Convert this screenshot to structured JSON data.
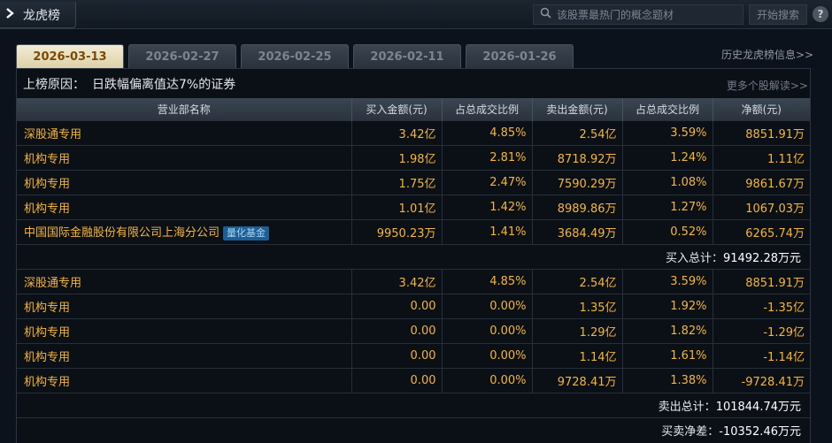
{
  "header": {
    "title": "龙虎榜",
    "search_placeholder": "该股票最热门的概念题材",
    "search_button": "开始搜索",
    "help_label": "?"
  },
  "tabs": [
    {
      "label": "2026-03-13",
      "active": true
    },
    {
      "label": "2026-02-27",
      "active": false
    },
    {
      "label": "2026-02-25",
      "active": false
    },
    {
      "label": "2026-02-11",
      "active": false
    },
    {
      "label": "2026-01-26",
      "active": false
    }
  ],
  "history_link": "历史龙虎榜信息>>",
  "reason": {
    "label": "上榜原因：",
    "value": "日跌幅偏离值达7%的证券"
  },
  "more_link": "更多个股解读>>",
  "columns": [
    "营业部名称",
    "买入金额(元)",
    "占总成交比例",
    "卖出金额(元)",
    "占总成交比例",
    "净额(元)"
  ],
  "buy_rows": [
    {
      "name": "深股通专用",
      "badge": "",
      "buy": "3.42亿",
      "buy_pct": "4.85%",
      "sell": "2.54亿",
      "sell_pct": "3.59%",
      "net": "8851.91万"
    },
    {
      "name": "机构专用",
      "badge": "",
      "buy": "1.98亿",
      "buy_pct": "2.81%",
      "sell": "8718.92万",
      "sell_pct": "1.24%",
      "net": "1.11亿"
    },
    {
      "name": "机构专用",
      "badge": "",
      "buy": "1.75亿",
      "buy_pct": "2.47%",
      "sell": "7590.29万",
      "sell_pct": "1.08%",
      "net": "9861.67万"
    },
    {
      "name": "机构专用",
      "badge": "",
      "buy": "1.01亿",
      "buy_pct": "1.42%",
      "sell": "8989.86万",
      "sell_pct": "1.27%",
      "net": "1067.03万"
    },
    {
      "name": "中国国际金融股份有限公司上海分公司",
      "badge": "量化基金",
      "buy": "9950.23万",
      "buy_pct": "1.41%",
      "sell": "3684.49万",
      "sell_pct": "0.52%",
      "net": "6265.74万"
    }
  ],
  "buy_total": {
    "label": "买入总计：",
    "value": "91492.28万元"
  },
  "sell_rows": [
    {
      "name": "深股通专用",
      "buy": "3.42亿",
      "buy_pct": "4.85%",
      "sell": "2.54亿",
      "sell_pct": "3.59%",
      "net": "8851.91万"
    },
    {
      "name": "机构专用",
      "buy": "0.00",
      "buy_pct": "0.00%",
      "sell": "1.35亿",
      "sell_pct": "1.92%",
      "net": "-1.35亿"
    },
    {
      "name": "机构专用",
      "buy": "0.00",
      "buy_pct": "0.00%",
      "sell": "1.29亿",
      "sell_pct": "1.82%",
      "net": "-1.29亿"
    },
    {
      "name": "机构专用",
      "buy": "0.00",
      "buy_pct": "0.00%",
      "sell": "1.14亿",
      "sell_pct": "1.61%",
      "net": "-1.14亿"
    },
    {
      "name": "机构专用",
      "buy": "0.00",
      "buy_pct": "0.00%",
      "sell": "9728.41万",
      "sell_pct": "1.38%",
      "net": "-9728.41万"
    }
  ],
  "sell_total": {
    "label": "卖出总计：",
    "value": "101844.74万元"
  },
  "net_total": {
    "label": "买卖净差：",
    "value": "-10352.46万元"
  }
}
